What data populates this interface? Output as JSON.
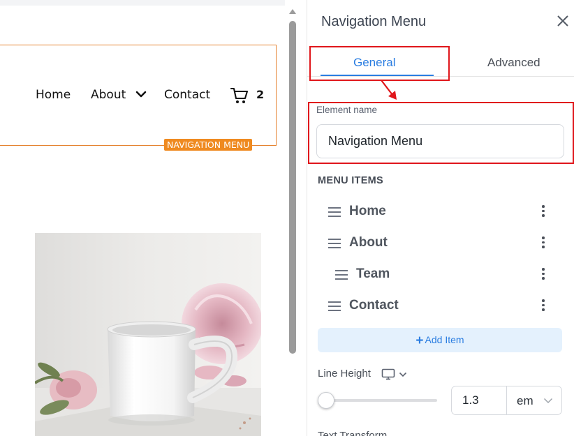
{
  "canvas": {
    "nav_links": [
      "Home",
      "About",
      "Contact"
    ],
    "cart_count": "2",
    "badge_label": "NAVIGATION MENU",
    "accent_color": "#ef8a20"
  },
  "panel": {
    "title": "Navigation Menu",
    "tabs": [
      {
        "label": "General",
        "active": true
      },
      {
        "label": "Advanced",
        "active": false
      }
    ],
    "element_name": {
      "label": "Element name",
      "value": "Navigation Menu"
    },
    "menu_items_title": "MENU ITEMS",
    "menu_items": [
      {
        "label": "Home"
      },
      {
        "label": "About"
      },
      {
        "label": "Team",
        "nested": true
      },
      {
        "label": "Contact"
      }
    ],
    "add_item_label": "Add Item",
    "line_height": {
      "label": "Line Height",
      "value": "1.3",
      "unit": "em",
      "slider_fraction": 0.0
    },
    "text_transform_label": "Text Transform"
  },
  "colors": {
    "highlight": "#e0161b",
    "primary": "#2a7de1"
  },
  "icons": [
    "close-icon",
    "chevron-down-icon",
    "cart-icon",
    "drag-handle-icon",
    "kebab-menu-icon",
    "plus-icon",
    "monitor-icon",
    "scroll-up-arrow-icon"
  ]
}
